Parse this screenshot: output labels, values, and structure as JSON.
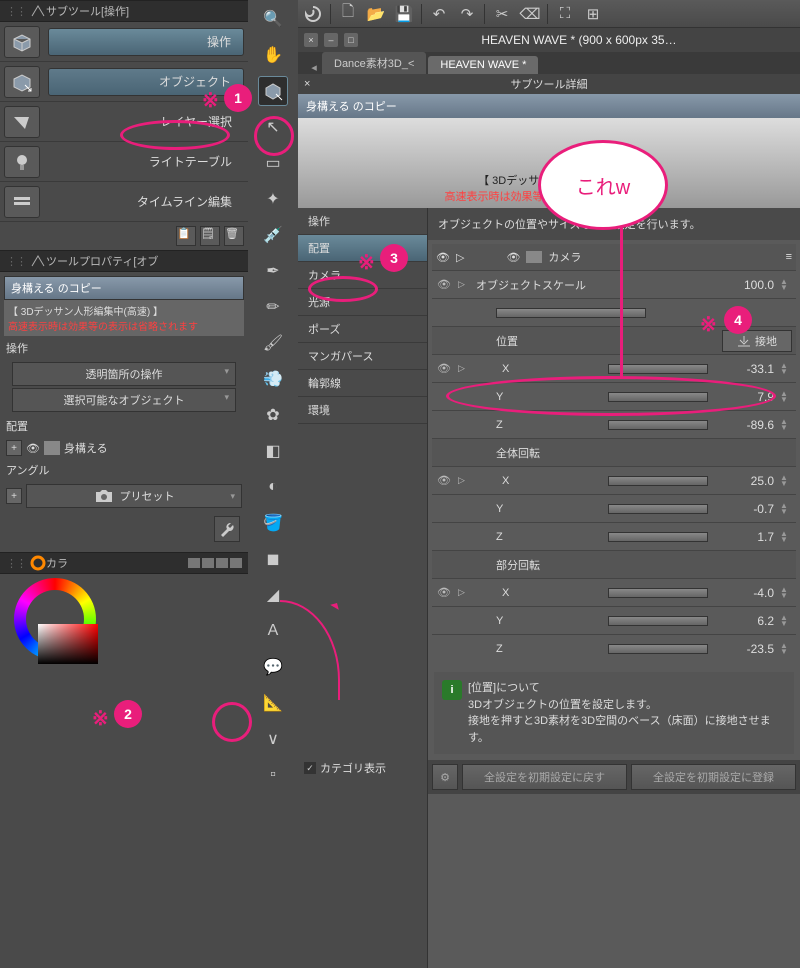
{
  "subtool_panel": {
    "title": "サブツール[操作]",
    "items": [
      {
        "label": "操作"
      },
      {
        "label": "オブジェクト"
      },
      {
        "label": "レイヤー選択"
      },
      {
        "label": "ライトテーブル"
      },
      {
        "label": "タイムライン編集"
      }
    ]
  },
  "tool_property": {
    "title": "ツールプロパティ[オブ",
    "copy_name": "身構える のコピー",
    "note1": "【 3Dデッサン人形編集中(高速) 】",
    "note2": "高速表示時は効果等の表示は省略されます",
    "section1": "操作",
    "field1": "透明箇所の操作",
    "field2": "選択可能なオブジェクト",
    "section2": "配置",
    "field3": "身構える",
    "section3": "アングル",
    "field4": "プリセット"
  },
  "color_panel": {
    "title": "カラ"
  },
  "window": {
    "title": "HEAVEN WAVE * (900 x 600px 35…",
    "tabs": [
      {
        "label": "Dance素材3D_<",
        "active": false
      },
      {
        "label": "HEAVEN WAVE *",
        "active": true
      }
    ]
  },
  "detail": {
    "title": "サブツール詳細",
    "copy_name": "身構える のコピー",
    "preview_note1": "【 3Dデッサン人形編集中(…",
    "preview_note2": "高速表示時は効果等の表示は省略されます",
    "categories": [
      "操作",
      "配置",
      "カメラ",
      "光源",
      "ポーズ",
      "マンガパース",
      "輪郭線",
      "環境"
    ],
    "selected_category_index": 1,
    "category_check": "カテゴリ表示",
    "desc": "オブジェクトの位置やサイズなどの設定を行います。",
    "camera_label": "カメラ",
    "scale_label": "オブジェクトスケール",
    "scale_value": "100.0",
    "pos_label": "位置",
    "ground_label": "接地",
    "coords": {
      "pos": {
        "X": "-33.1",
        "Y": "7.9",
        "Z": "-89.6"
      },
      "rot_all_label": "全体回転",
      "rot_all": {
        "X": "25.0",
        "Y": "-0.7",
        "Z": "1.7"
      },
      "rot_part_label": "部分回転",
      "rot_part": {
        "X": "-4.0",
        "Y": "6.2",
        "Z": "-23.5"
      }
    },
    "info_title": "[位置]について",
    "info_text": "3Dオブジェクトの位置を設定します。\n接地を押すと3D素材を3D空間のベース（床面）に接地させます。",
    "btn_reset": "全設定を初期設定に戻す",
    "btn_save": "全設定を初期設定に登録"
  },
  "annotations": {
    "bubble": "これw",
    "marks": [
      "※",
      "※",
      "※",
      "※"
    ],
    "nums": [
      "1",
      "2",
      "3",
      "4"
    ]
  }
}
